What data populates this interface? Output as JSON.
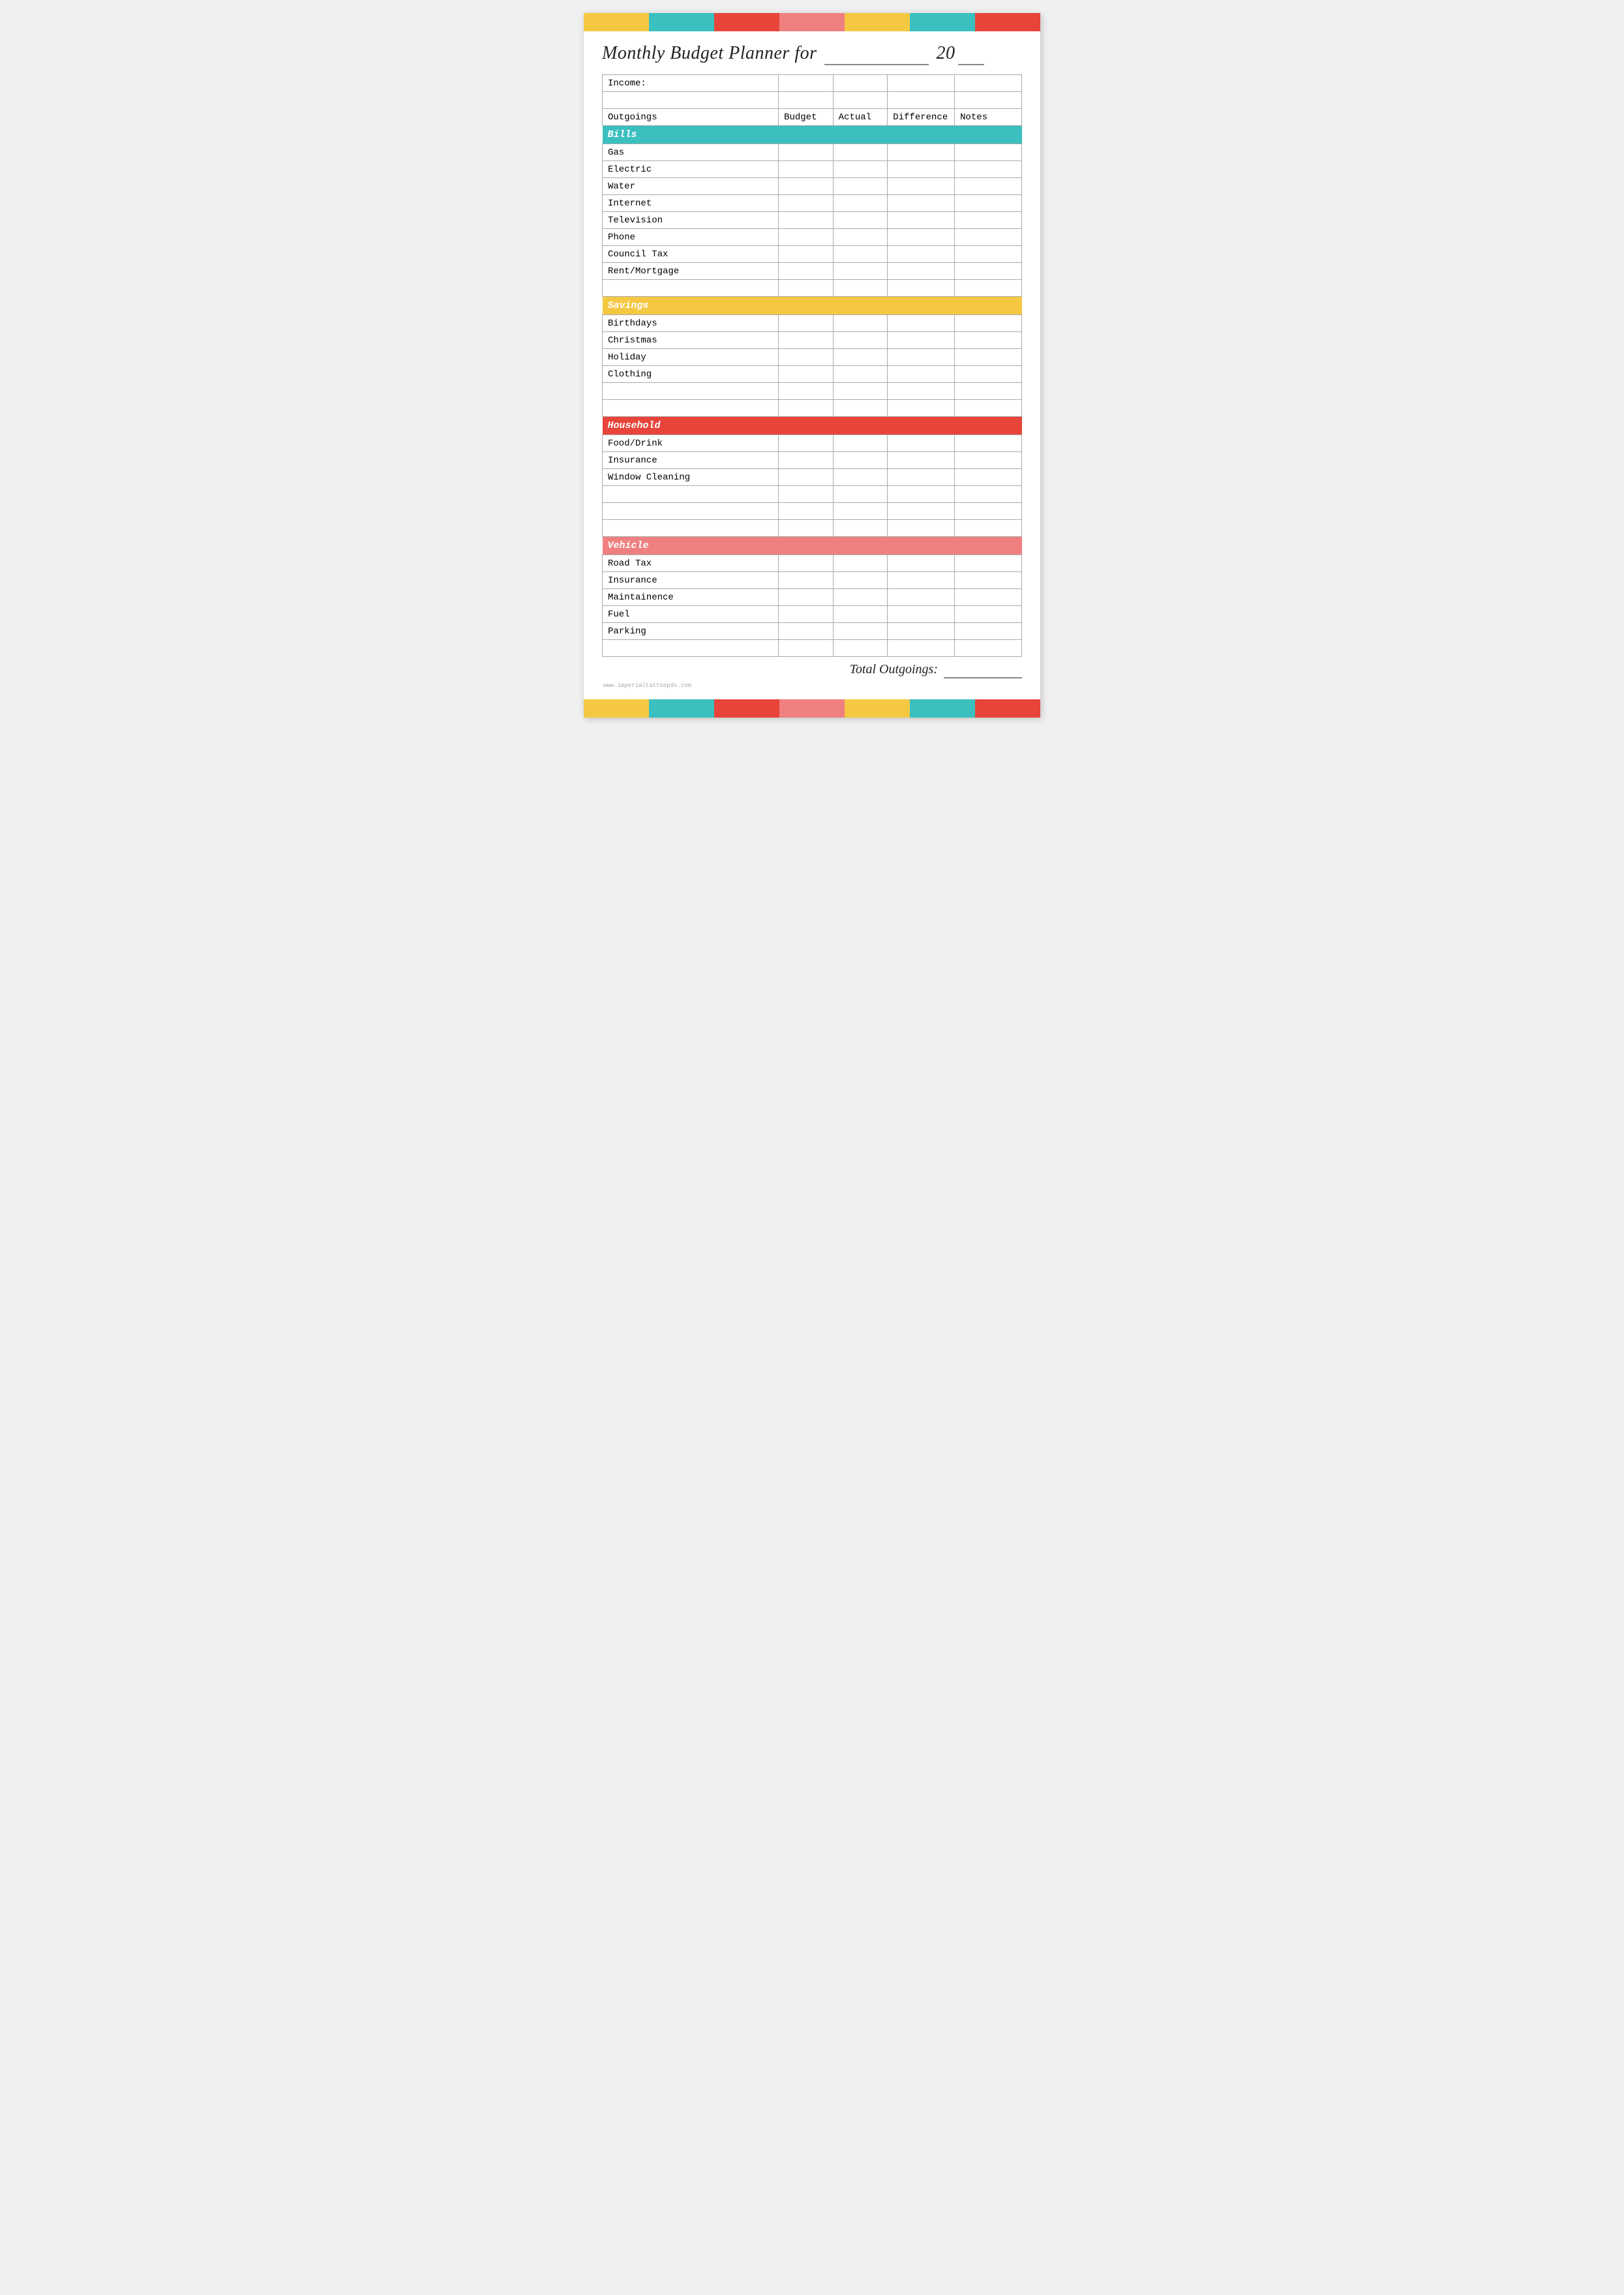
{
  "page": {
    "title_part1": "Monthly Budget Planner for",
    "title_year": "20",
    "color_bars": [
      {
        "color": "yellow",
        "class": "bar-yellow"
      },
      {
        "color": "teal",
        "class": "bar-teal"
      },
      {
        "color": "red",
        "class": "bar-red"
      },
      {
        "color": "pink",
        "class": "bar-pink"
      },
      {
        "color": "yellow",
        "class": "bar-yellow2"
      },
      {
        "color": "teal",
        "class": "bar-teal2"
      },
      {
        "color": "red",
        "class": "bar-red2"
      }
    ]
  },
  "table": {
    "income_label": "Income:",
    "headers": {
      "outgoings": "Outgoings",
      "budget": "Budget",
      "actual": "Actual",
      "difference": "Difference",
      "notes": "Notes"
    },
    "sections": [
      {
        "name": "Bills",
        "rows": [
          "Gas",
          "Electric",
          "Water",
          "Internet",
          "Television",
          "Phone",
          "Council Tax",
          "Rent/Mortgage",
          ""
        ]
      },
      {
        "name": "Savings",
        "rows": [
          "Birthdays",
          "Christmas",
          "Holiday",
          "Clothing",
          "",
          ""
        ]
      },
      {
        "name": "Household",
        "rows": [
          "Food/Drink",
          "Insurance",
          "Window Cleaning",
          "",
          "",
          ""
        ]
      },
      {
        "name": "Vehicle",
        "rows": [
          "Road Tax",
          "Insurance",
          "Maintainence",
          "Fuel",
          "Parking",
          ""
        ]
      }
    ],
    "total_label": "Total Outgoings:",
    "total_value": "_____"
  },
  "watermark": "www.imperialtattoopds.com"
}
